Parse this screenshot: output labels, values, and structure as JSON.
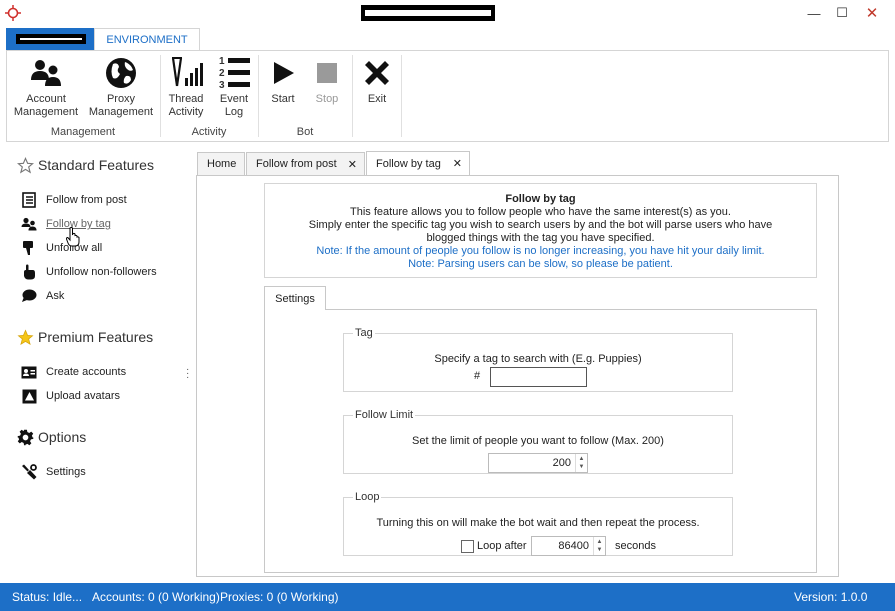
{
  "window": {
    "minimize_glyph": "—",
    "maximize_glyph": "☐",
    "close_glyph": "✕"
  },
  "ribbon": {
    "tab_environment": "ENVIRONMENT",
    "groups": {
      "management": "Management",
      "activity": "Activity",
      "bot": "Bot"
    },
    "buttons": {
      "account_management_1": "Account",
      "account_management_2": "Management",
      "proxy_management_1": "Proxy",
      "proxy_management_2": "Management",
      "thread_activity_1": "Thread",
      "thread_activity_2": "Activity",
      "event_log_1": "Event",
      "event_log_2": "Log",
      "start": "Start",
      "stop": "Stop",
      "exit": "Exit"
    },
    "event_log_numbers": [
      "1",
      "2",
      "3"
    ]
  },
  "sidebar": {
    "standard_title": "Standard Features",
    "standard_items": [
      "Follow from post",
      "Follow by tag",
      "Unfollow all",
      "Unfollow non-followers",
      "Ask"
    ],
    "premium_title": "Premium Features",
    "premium_items": [
      "Create accounts",
      "Upload avatars"
    ],
    "options_title": "Options",
    "options_items": [
      "Settings"
    ]
  },
  "tabs": {
    "home": "Home",
    "follow_from_post": "Follow from post",
    "follow_by_tag": "Follow by tag",
    "close_glyph": "✕"
  },
  "info": {
    "title": "Follow by tag",
    "line1": "This feature allows you to follow people who have the same interest(s) as you.",
    "line2": "Simply enter the specific tag you wish to search users by and the bot will parse users who have",
    "line3": "blogged things with the tag you have specified.",
    "note1": "Note: If the amount of people you follow is no longer increasing, you have hit your daily limit.",
    "note2": "Note: Parsing users can be slow, so please be patient."
  },
  "settings": {
    "tab_label": "Settings",
    "tag": {
      "legend": "Tag",
      "description": "Specify a tag to search with (E.g. Puppies)",
      "prefix": "#",
      "value": ""
    },
    "follow_limit": {
      "legend": "Follow Limit",
      "description": "Set the limit of people you want to follow (Max. 200)",
      "value": "200"
    },
    "loop": {
      "legend": "Loop",
      "description": "Turning this on will make the bot wait and then repeat the process.",
      "checkbox_label": "Loop after",
      "checked": false,
      "value": "86400",
      "unit": "seconds"
    }
  },
  "status": {
    "status": "Status: Idle...",
    "accounts": "Accounts: 0 (0 Working)",
    "proxies": "Proxies: 0 (0 Working)",
    "version": "Version: 1.0.0"
  },
  "colors": {
    "accent": "#1d6fc7",
    "note": "#1d6fc7",
    "app_icon": "#d0312d"
  }
}
